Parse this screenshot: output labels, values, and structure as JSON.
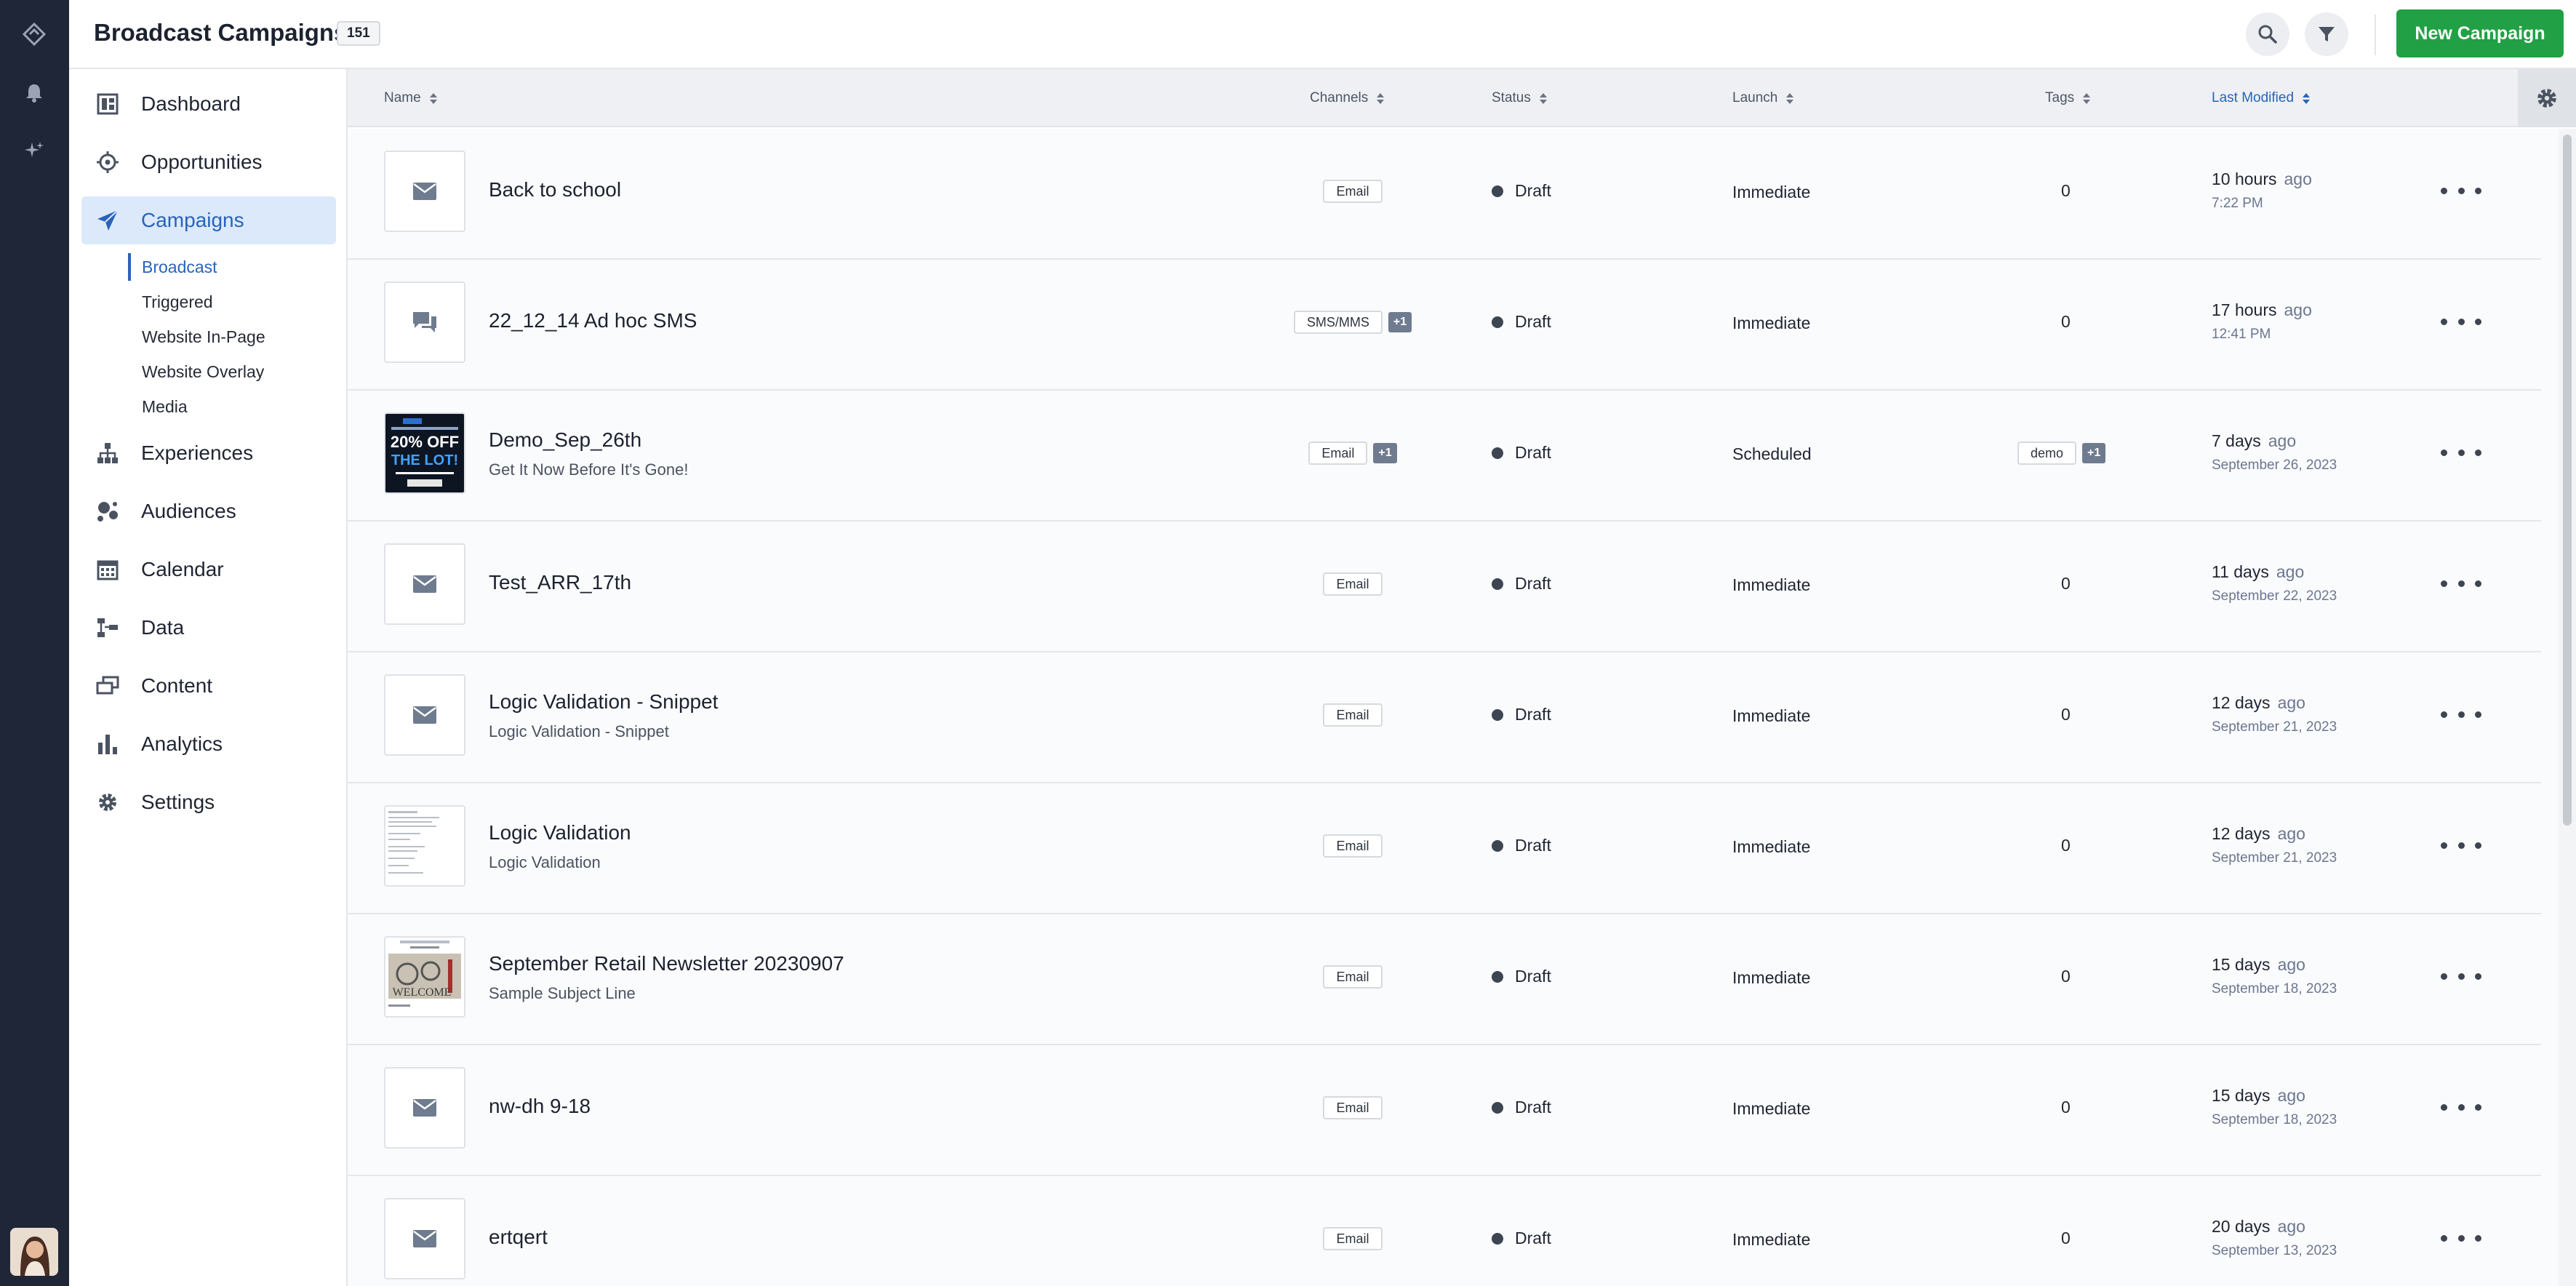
{
  "header": {
    "title": "Broadcast Campaigns",
    "count": "151",
    "new_button": "New Campaign"
  },
  "nav": {
    "items": [
      {
        "label": "Dashboard",
        "icon": "dashboard-icon"
      },
      {
        "label": "Opportunities",
        "icon": "target-icon"
      },
      {
        "label": "Campaigns",
        "icon": "paper-plane-icon",
        "active": true
      },
      {
        "label": "Experiences",
        "icon": "hierarchy-icon"
      },
      {
        "label": "Audiences",
        "icon": "audience-icon"
      },
      {
        "label": "Calendar",
        "icon": "calendar-icon"
      },
      {
        "label": "Data",
        "icon": "data-icon"
      },
      {
        "label": "Content",
        "icon": "content-icon"
      },
      {
        "label": "Analytics",
        "icon": "bar-chart-icon"
      },
      {
        "label": "Settings",
        "icon": "gear-icon"
      }
    ],
    "sub_items": [
      {
        "label": "Broadcast",
        "active": true
      },
      {
        "label": "Triggered"
      },
      {
        "label": "Website In-Page"
      },
      {
        "label": "Website Overlay"
      },
      {
        "label": "Media"
      }
    ]
  },
  "table": {
    "columns": [
      "Name",
      "Channels",
      "Status",
      "Launch",
      "Tags",
      "Last Modified"
    ],
    "sorted_column": "Last Modified",
    "rows": [
      {
        "name": "Back to school",
        "subtitle": "",
        "thumb": "email",
        "channel": "Email",
        "channel_extra": "",
        "status": "Draft",
        "launch": "Immediate",
        "tag": "",
        "tag_extra": "",
        "tag_count": "0",
        "modified_rel": "10 hours",
        "ago": "ago",
        "modified_abs": "7:22 PM"
      },
      {
        "name": "22_12_14 Ad hoc SMS",
        "subtitle": "",
        "thumb": "sms",
        "channel": "SMS/MMS",
        "channel_extra": "+1",
        "status": "Draft",
        "launch": "Immediate",
        "tag": "",
        "tag_extra": "",
        "tag_count": "0",
        "modified_rel": "17 hours",
        "ago": "ago",
        "modified_abs": "12:41 PM"
      },
      {
        "name": "Demo_Sep_26th",
        "subtitle": "Get It Now Before It's Gone!",
        "thumb": "promo",
        "channel": "Email",
        "channel_extra": "+1",
        "status": "Draft",
        "launch": "Scheduled",
        "tag": "demo",
        "tag_extra": "+1",
        "tag_count": "",
        "modified_rel": "7 days",
        "ago": "ago",
        "modified_abs": "September 26, 2023"
      },
      {
        "name": "Test_ARR_17th",
        "subtitle": "",
        "thumb": "email",
        "channel": "Email",
        "channel_extra": "",
        "status": "Draft",
        "launch": "Immediate",
        "tag": "",
        "tag_extra": "",
        "tag_count": "0",
        "modified_rel": "11 days",
        "ago": "ago",
        "modified_abs": "September 22, 2023"
      },
      {
        "name": "Logic Validation - Snippet",
        "subtitle": "Logic Validation - Snippet",
        "thumb": "email",
        "channel": "Email",
        "channel_extra": "",
        "status": "Draft",
        "launch": "Immediate",
        "tag": "",
        "tag_extra": "",
        "tag_count": "0",
        "modified_rel": "12 days",
        "ago": "ago",
        "modified_abs": "September 21, 2023"
      },
      {
        "name": "Logic Validation",
        "subtitle": "Logic Validation",
        "thumb": "doc",
        "channel": "Email",
        "channel_extra": "",
        "status": "Draft",
        "launch": "Immediate",
        "tag": "",
        "tag_extra": "",
        "tag_count": "0",
        "modified_rel": "12 days",
        "ago": "ago",
        "modified_abs": "September 21, 2023"
      },
      {
        "name": "September Retail Newsletter 20230907",
        "subtitle": "Sample Subject Line",
        "thumb": "newsletter",
        "channel": "Email",
        "channel_extra": "",
        "status": "Draft",
        "launch": "Immediate",
        "tag": "",
        "tag_extra": "",
        "tag_count": "0",
        "modified_rel": "15 days",
        "ago": "ago",
        "modified_abs": "September 18, 2023"
      },
      {
        "name": "nw-dh 9-18",
        "subtitle": "",
        "thumb": "email",
        "channel": "Email",
        "channel_extra": "",
        "status": "Draft",
        "launch": "Immediate",
        "tag": "",
        "tag_extra": "",
        "tag_count": "0",
        "modified_rel": "15 days",
        "ago": "ago",
        "modified_abs": "September 18, 2023"
      },
      {
        "name": "ertqert",
        "subtitle": "",
        "thumb": "email",
        "channel": "Email",
        "channel_extra": "",
        "status": "Draft",
        "launch": "Immediate",
        "tag": "",
        "tag_extra": "",
        "tag_count": "0",
        "modified_rel": "20 days",
        "ago": "ago",
        "modified_abs": "September 13, 2023"
      }
    ]
  },
  "promo_thumb": {
    "line1": "20% OFF",
    "line2": "THE LOT!"
  },
  "newsletter_thumb": {
    "text": "WELCOME"
  },
  "colors": {
    "accent": "#2a63b9",
    "primary_button": "#22a045",
    "rail": "#1f2637"
  }
}
